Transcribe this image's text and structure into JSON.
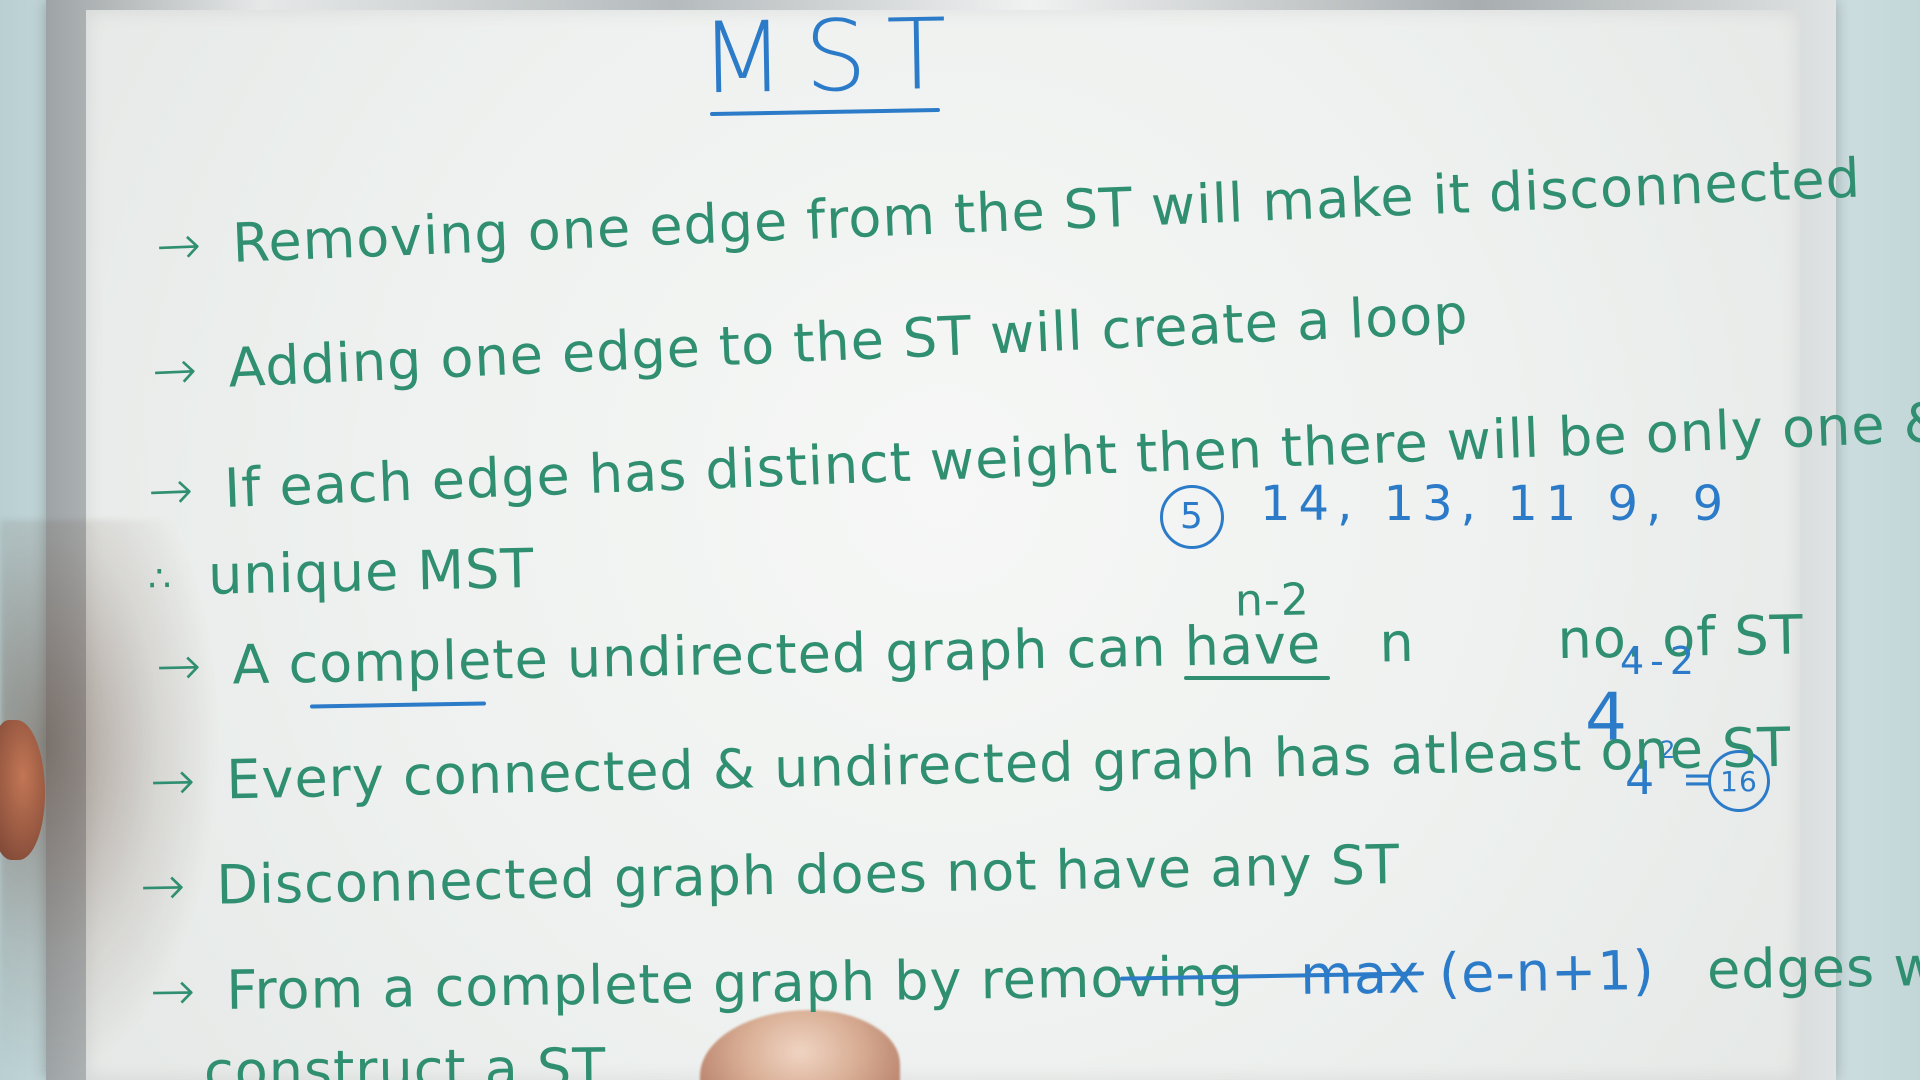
{
  "board": {
    "title": "MST",
    "lines": [
      "Removing one edge from the ST will make it disconnected",
      "Adding one edge to the ST will create a loop",
      "If each edge has distinct weight then there will be only one &",
      "unique MST",
      "A complete undirected graph can have",
      "no. of ST",
      "Every connected & undirected graph has atleast one ST",
      "Disconnected graph does not have any ST",
      "From a complete graph by removing",
      "edges we can",
      "construct a ST"
    ],
    "math": {
      "power_base": "n",
      "power_exp": "n-2",
      "max_expr": "max (e-n+1)",
      "circled_five": "5",
      "weights": "14, 13, 11 9, 9",
      "example_exp": "4-2",
      "example_base": "4",
      "example_square_base": "4",
      "example_square_exp": "2",
      "equals": "=",
      "example_result": "16"
    },
    "symbols": {
      "arrow": "→",
      "therefore": "∴"
    }
  }
}
